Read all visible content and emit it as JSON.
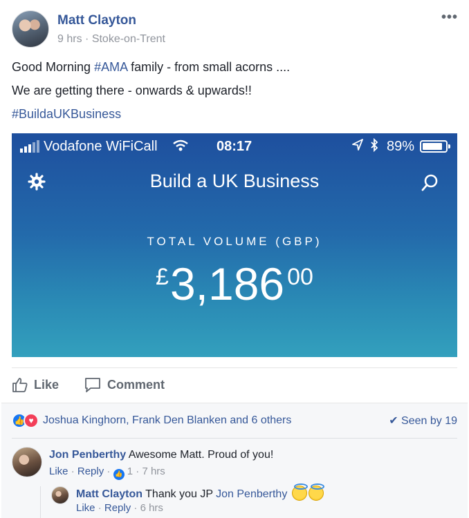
{
  "post": {
    "author": "Matt Clayton",
    "time": "9 hrs",
    "separator": "·",
    "location": "Stoke-on-Trent",
    "more_glyph": "•••",
    "line1_before": "Good Morning ",
    "line1_hashtag": "#AMA",
    "line1_after": " family - from small acorns ....",
    "line2": "We are getting there - onwards & upwards!!",
    "line3_hashtag": "#BuildaUKBusiness"
  },
  "screenshot": {
    "carrier": "Vodafone WiFiCall",
    "time": "08:17",
    "battery": "89%",
    "battery_level": 0.89,
    "app_title": "Build a UK Business",
    "volume_label": "TOTAL VOLUME (GBP)",
    "currency": "£",
    "amount": "3,186",
    "decimals": "00",
    "gradient_colors": [
      "#1e4f9e",
      "#236aab",
      "#2a8ab5",
      "#33a0bd"
    ]
  },
  "actions": {
    "like": "Like",
    "comment": "Comment"
  },
  "reactions": {
    "names": "Joshua Kinghorn, Frank Den Blanken and 6 others",
    "seen": "Seen by 19"
  },
  "comments": [
    {
      "author": "Jon Penberthy",
      "text": " Awesome Matt. Proud of you!",
      "like": "Like",
      "reply": "Reply",
      "like_count": "1",
      "time": "7 hrs"
    }
  ],
  "reply": {
    "author": "Matt Clayton",
    "text": " Thank you JP ",
    "mention": "Jon Penberthy",
    "like": "Like",
    "reply": "Reply",
    "time": "6 hrs"
  },
  "colors": {
    "link": "#365899",
    "like_blue": "#1877f2",
    "love_red": "#f33e58"
  }
}
